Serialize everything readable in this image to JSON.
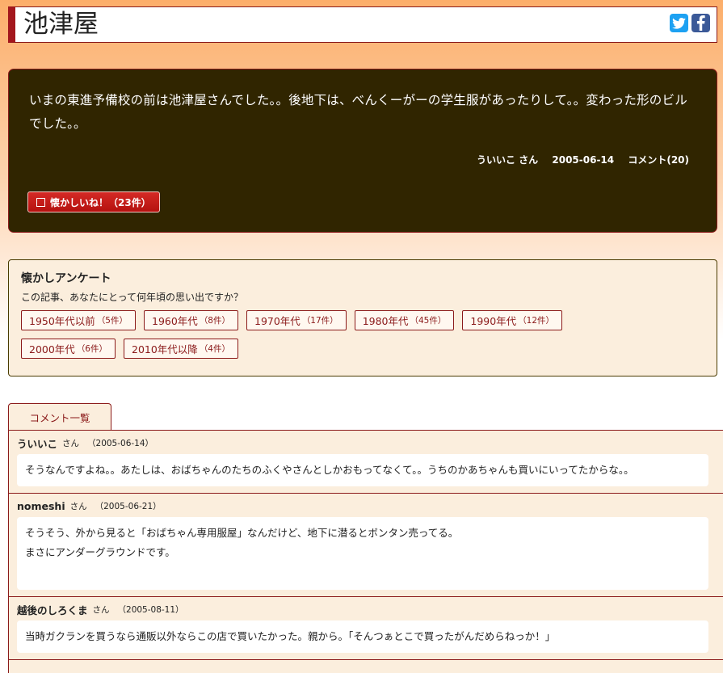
{
  "page": {
    "title": "池津屋"
  },
  "share": {
    "twitter": "t",
    "facebook": "f"
  },
  "story": {
    "body": "いまの東進予備校の前は池津屋さんでした。。後地下は、べんくーがーの学生服があったりして。。変わった形のビルでした。。",
    "author": "ういいこ さん",
    "date": "2005-06-14",
    "comments": "コメント(20)",
    "like_label": "懐かしいね！（",
    "like_count": "23件",
    "like_close": "）"
  },
  "survey": {
    "title": "懐かしアンケート",
    "question": "この記事、あなたにとって何年頃の思い出ですか？",
    "options": [
      {
        "label": "1950年代以前",
        "count": "（5件）"
      },
      {
        "label": "1960年代",
        "count": "（8件）"
      },
      {
        "label": "1970年代",
        "count": "（17件）"
      },
      {
        "label": "1980年代",
        "count": "（45件）"
      },
      {
        "label": "1990年代",
        "count": "（12件）"
      },
      {
        "label": "2000年代",
        "count": "（6件）"
      },
      {
        "label": "2010年代以降",
        "count": "（4件）"
      }
    ]
  },
  "comments_tab": "コメント一覧",
  "comments": [
    {
      "name": "ういいこ",
      "san": "さん",
      "date": "（2005-06-14）",
      "lines": [
        "そうなんですよね。。あたしは、おばちゃんのたちのふくやさんとしかおもってなくて。。うちのかあちゃんも買いにいってたからな。。"
      ]
    },
    {
      "name": "nomeshi",
      "san": "さん",
      "date": "（2005-06-21）",
      "lines": [
        "そうそう、外から見ると「おばちゃん専用服屋」なんだけど、地下に潜るとボンタン売ってる。",
        "まさにアンダーグラウンドです。"
      ]
    },
    {
      "name": "越後のしろくま",
      "san": "さん",
      "date": "（2005-08-11）",
      "lines": [
        "当時ガクランを買うなら通販以外ならこの店で買いたかった。親から。「そんつぁとこで買ったがんだめらねっか！」"
      ]
    }
  ]
}
